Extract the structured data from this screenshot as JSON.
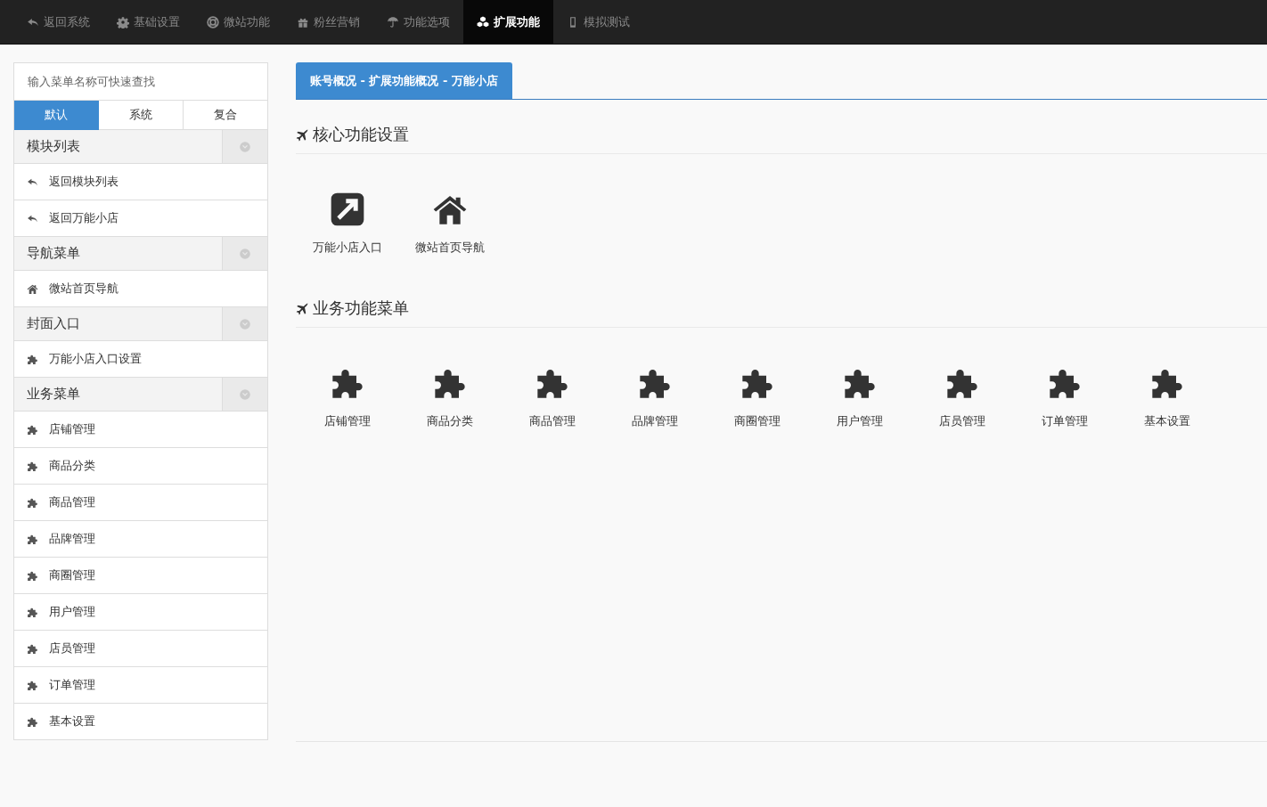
{
  "nav": [
    {
      "label": "返回系统",
      "kind": "back",
      "selected": false
    },
    {
      "label": "基础设置",
      "kind": "gear",
      "selected": false
    },
    {
      "label": "微站功能",
      "kind": "lifebuoy",
      "selected": false
    },
    {
      "label": "粉丝营销",
      "kind": "gift",
      "selected": false
    },
    {
      "label": "功能选项",
      "kind": "umbrella",
      "selected": false
    },
    {
      "label": "扩展功能",
      "kind": "cubes",
      "selected": true
    },
    {
      "label": "模拟测试",
      "kind": "phone",
      "selected": false
    }
  ],
  "sidebar": {
    "search": {
      "placeholder": "输入菜单名称可快速查找"
    },
    "tabs": [
      {
        "label": "默认",
        "selected": true
      },
      {
        "label": "系统",
        "selected": false
      },
      {
        "label": "复合",
        "selected": false
      }
    ],
    "groups": [
      {
        "title": "模块列表",
        "items": [
          {
            "label": "返回模块列表",
            "kind": "back"
          },
          {
            "label": "返回万能小店",
            "kind": "back"
          }
        ]
      },
      {
        "title": "导航菜单",
        "items": [
          {
            "label": "微站首页导航",
            "kind": "home"
          }
        ]
      },
      {
        "title": "封面入口",
        "items": [
          {
            "label": "万能小店入口设置",
            "kind": "puzzle"
          }
        ]
      },
      {
        "title": "业务菜单",
        "items": [
          {
            "label": "店铺管理",
            "kind": "puzzle"
          },
          {
            "label": "商品分类",
            "kind": "puzzle"
          },
          {
            "label": "商品管理",
            "kind": "puzzle"
          },
          {
            "label": "品牌管理",
            "kind": "puzzle"
          },
          {
            "label": "商圈管理",
            "kind": "puzzle"
          },
          {
            "label": "用户管理",
            "kind": "puzzle"
          },
          {
            "label": "店员管理",
            "kind": "puzzle"
          },
          {
            "label": "订单管理",
            "kind": "puzzle"
          },
          {
            "label": "基本设置",
            "kind": "puzzle"
          }
        ]
      }
    ]
  },
  "main": {
    "breadcrumb": "账号概况 - 扩展功能概况 - 万能小店",
    "sections": [
      {
        "title": "核心功能设置",
        "items": [
          {
            "label": "万能小店入口",
            "kind": "external"
          },
          {
            "label": "微站首页导航",
            "kind": "home"
          }
        ]
      },
      {
        "title": "业务功能菜单",
        "items": [
          {
            "label": "店铺管理",
            "kind": "puzzle"
          },
          {
            "label": "商品分类",
            "kind": "puzzle"
          },
          {
            "label": "商品管理",
            "kind": "puzzle"
          },
          {
            "label": "品牌管理",
            "kind": "puzzle"
          },
          {
            "label": "商圈管理",
            "kind": "puzzle"
          },
          {
            "label": "用户管理",
            "kind": "puzzle"
          },
          {
            "label": "店员管理",
            "kind": "puzzle"
          },
          {
            "label": "订单管理",
            "kind": "puzzle"
          },
          {
            "label": "基本设置",
            "kind": "puzzle"
          }
        ]
      }
    ]
  }
}
